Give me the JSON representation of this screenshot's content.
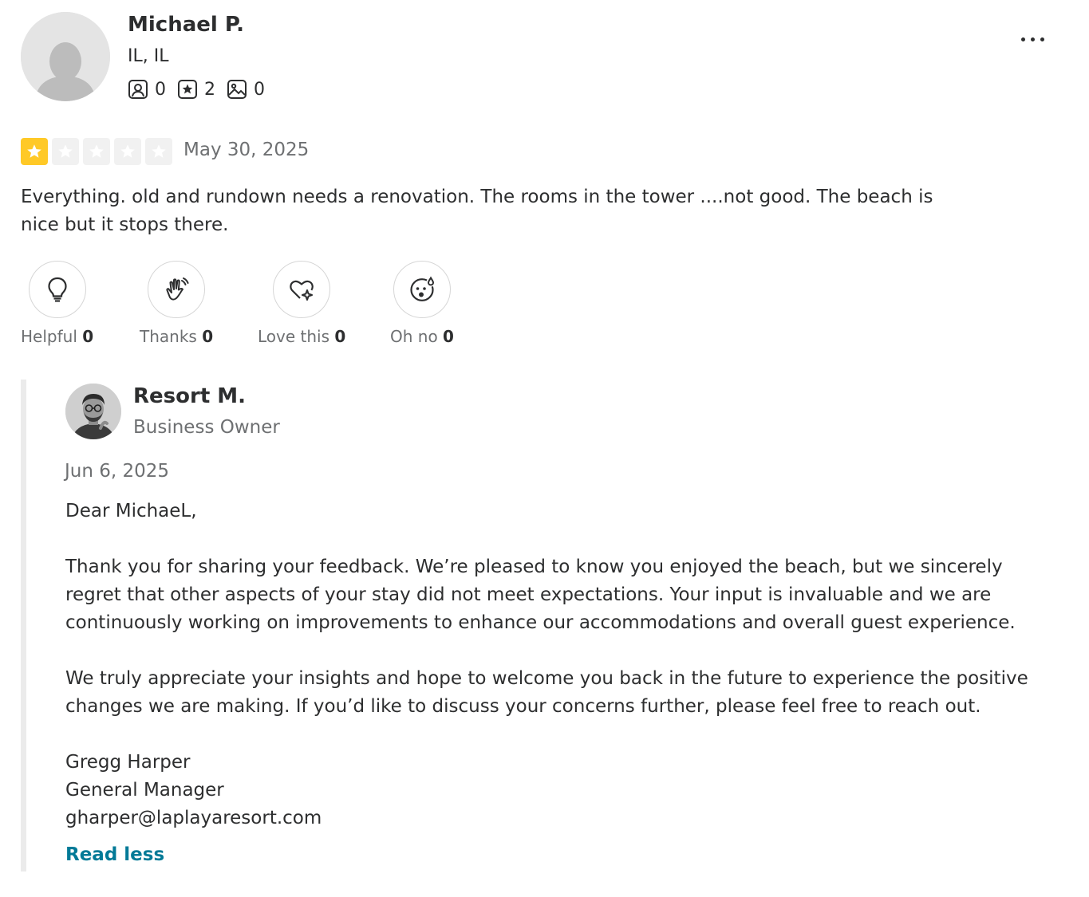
{
  "reviewer": {
    "name": "Michael P.",
    "location": "IL, IL",
    "stats": [
      {
        "icon": "friends-icon",
        "count": "0"
      },
      {
        "icon": "review-star-icon",
        "count": "2"
      },
      {
        "icon": "photo-icon",
        "count": "0"
      }
    ]
  },
  "review": {
    "rating": 1,
    "rating_max": 5,
    "date": "May 30, 2025",
    "text": "Everything. old and rundown needs a renovation. The rooms in the tower ....not good. The beach is nice but it stops there."
  },
  "reactions": [
    {
      "icon": "lightbulb-icon",
      "label": "Helpful",
      "count": "0"
    },
    {
      "icon": "waving-hands-icon",
      "label": "Thanks",
      "count": "0"
    },
    {
      "icon": "heart-sparkle-icon",
      "label": "Love this",
      "count": "0"
    },
    {
      "icon": "shocked-face-icon",
      "label": "Oh no",
      "count": "0"
    }
  ],
  "reply": {
    "owner_name": "Resort M.",
    "owner_role": "Business Owner",
    "date": "Jun 6, 2025",
    "greeting": "Dear MichaeL,",
    "paragraph_1": "Thank you for sharing your feedback. We’re pleased to know you enjoyed the beach, but we sincerely regret that other aspects of your stay did not meet expectations. Your input is invaluable and we are continuously working on improvements to enhance our accommodations and overall guest experience.",
    "paragraph_2": "We truly appreciate your insights and hope to welcome you back in the future to experience the positive changes we are making. If you’d like to discuss your concerns further, please feel free to reach out.",
    "signature_name": "Gregg Harper",
    "signature_title": "General Manager",
    "signature_email": "gharper@laplayaresort.com",
    "read_less_label": "Read less"
  },
  "colors": {
    "star_filled": "#ffc927",
    "star_empty": "#f1f1f1",
    "link": "#027a97",
    "reply_border": "#ebebeb"
  }
}
